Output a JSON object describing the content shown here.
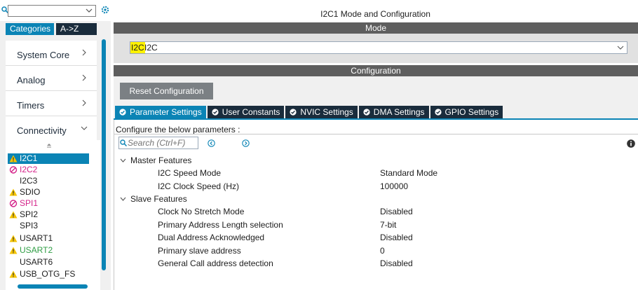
{
  "left_panel": {
    "search_value": "",
    "tabs": [
      "Categories",
      "A->Z"
    ],
    "categories": [
      {
        "label": "System Core"
      },
      {
        "label": "Analog"
      },
      {
        "label": "Timers"
      },
      {
        "label": "Connectivity"
      }
    ],
    "peripherals": [
      {
        "label": "I2C1",
        "status": "warning",
        "selected": true
      },
      {
        "label": "I2C2",
        "status": "disabled"
      },
      {
        "label": "I2C3",
        "status": "none"
      },
      {
        "label": "SDIO",
        "status": "warning"
      },
      {
        "label": "SPI1",
        "status": "disabled"
      },
      {
        "label": "SPI2",
        "status": "warning"
      },
      {
        "label": "SPI3",
        "status": "none"
      },
      {
        "label": "USART1",
        "status": "warning"
      },
      {
        "label": "USART2",
        "status": "ok-warning"
      },
      {
        "label": "USART6",
        "status": "none"
      },
      {
        "label": "USB_OTG_FS",
        "status": "warning"
      }
    ]
  },
  "right_panel": {
    "title": "I2C1 Mode and Configuration",
    "mode_header": "Mode",
    "mode_select": {
      "highlight": "I2C",
      "value": "I2C"
    },
    "config_header": "Configuration",
    "reset_label": "Reset Configuration",
    "tabs": [
      {
        "label": "Parameter Settings",
        "active": true
      },
      {
        "label": "User Constants"
      },
      {
        "label": "NVIC Settings"
      },
      {
        "label": "DMA Settings"
      },
      {
        "label": "GPIO Settings"
      }
    ],
    "caption": "Configure the below parameters :",
    "search_placeholder": "Search (Ctrl+F)",
    "groups": [
      {
        "title": "Master Features",
        "params": [
          {
            "name": "I2C Speed Mode",
            "value": "Standard Mode"
          },
          {
            "name": "I2C Clock Speed (Hz)",
            "value": "100000"
          }
        ]
      },
      {
        "title": "Slave Features",
        "params": [
          {
            "name": "Clock No Stretch Mode",
            "value": "Disabled"
          },
          {
            "name": "Primary Address Length selection",
            "value": "7-bit"
          },
          {
            "name": "Dual Address Acknowledged",
            "value": "Disabled"
          },
          {
            "name": "Primary slave address",
            "value": "0"
          },
          {
            "name": "General Call address detection",
            "value": "Disabled"
          }
        ]
      }
    ]
  },
  "colors": {
    "accent": "#0b84b5",
    "dark_tab": "#1a2c3c",
    "header_bar": "#5e5e5e",
    "warning": "#f5c400",
    "disabled": "#d4238a",
    "ok_green": "#2f9e45",
    "highlight": "#fff200"
  },
  "icons": {
    "search": "search-icon",
    "gear": "gear-icon",
    "warning": "warning-icon",
    "disabled": "prohibited-icon",
    "check": "check-circle-icon",
    "info": "info-icon"
  }
}
